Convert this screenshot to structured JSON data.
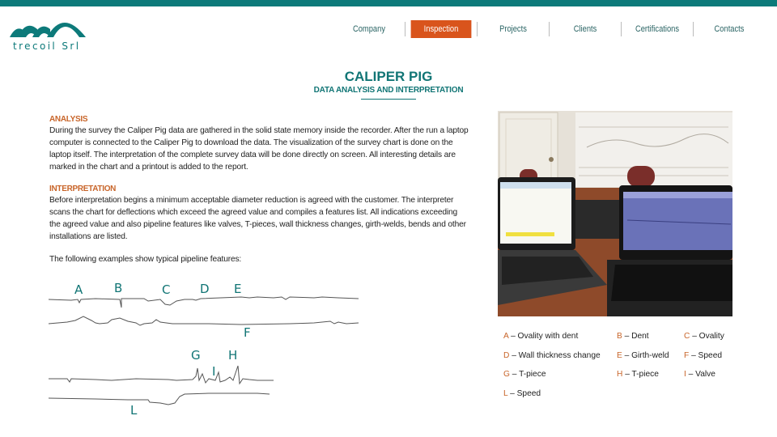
{
  "brand": {
    "name": "trecoil Srl",
    "color": "#0d7a7a"
  },
  "nav": {
    "items": [
      {
        "label": "Company",
        "active": false
      },
      {
        "label": "Inspection",
        "active": true
      },
      {
        "label": "Projects",
        "active": false
      },
      {
        "label": "Clients",
        "active": false
      },
      {
        "label": "Certifications",
        "active": false
      },
      {
        "label": "Contacts",
        "active": false
      }
    ],
    "active_color": "#d9541c"
  },
  "page": {
    "title": "CALIPER PIG",
    "subtitle": "DATA ANALYSIS AND INTERPRETATION"
  },
  "analysis": {
    "heading": "ANALYSIS",
    "text": "During the survey the Caliper Pig data are gathered in the solid state memory inside the recorder.  After the run a laptop computer is connected to the Caliper Pig to download the data. The visualization of the survey chart is done on the laptop itself. The interpretation of the complete survey data will be done directly on screen. All interesting details are marked in the chart and a printout is added to the report."
  },
  "interpretation": {
    "heading": "INTERPRETATION",
    "text": "Before interpretation begins a minimum acceptable diameter reduction is agreed with the customer. The interpreter scans the chart for deflections which exceed the agreed value and compiles a features list. All indications exceeding the agreed value and also pipeline features like valves, T-pieces, wall thickness changes, girth-welds, bends and other installations are listed.",
    "examples_intro": "The following examples show typical pipeline features:"
  },
  "chart_labels": [
    "A",
    "B",
    "C",
    "D",
    "E",
    "F",
    "G",
    "H",
    "I",
    "L"
  ],
  "legend": [
    {
      "letter": "A",
      "text": " – Ovality with dent"
    },
    {
      "letter": "B",
      "text": " – Dent"
    },
    {
      "letter": "C",
      "text": " – Ovality"
    },
    {
      "letter": "D",
      "text": " – Wall thickness change"
    },
    {
      "letter": "E",
      "text": " – Girth-weld"
    },
    {
      "letter": "F",
      "text": " – Speed"
    },
    {
      "letter": "G",
      "text": " – T-piece"
    },
    {
      "letter": "H",
      "text": " – T-piece"
    },
    {
      "letter": "I",
      "text": " – Valve"
    },
    {
      "letter": "L",
      "text": " – Speed"
    }
  ],
  "photo": {
    "description": "Two laptops displaying caliper pig survey data with printed survey chart on wall"
  }
}
